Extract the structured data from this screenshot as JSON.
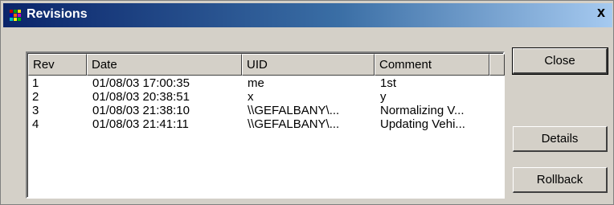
{
  "window": {
    "title": "Revisions",
    "close_glyph": "x"
  },
  "list": {
    "columns": [
      "Rev",
      "Date",
      "UID",
      "Comment"
    ],
    "rows": [
      [
        "1",
        "01/08/03  17:00:35",
        "me",
        "1st"
      ],
      [
        "2",
        "01/08/03  20:38:51",
        "x",
        "y"
      ],
      [
        "3",
        "01/08/03  21:38:10",
        "\\\\GEFALBANY\\...",
        "Normalizing V..."
      ],
      [
        "4",
        "01/08/03  21:41:11",
        "\\\\GEFALBANY\\...",
        "Updating Vehi..."
      ]
    ]
  },
  "buttons": {
    "close": "Close",
    "details": "Details",
    "rollback": "Rollback"
  },
  "colors": {
    "titlebar_start": "#0a246a",
    "titlebar_end": "#a6caf0",
    "face": "#d4d0c8"
  },
  "icons": {
    "app": "revisions-app-icon",
    "close": "close-icon"
  }
}
